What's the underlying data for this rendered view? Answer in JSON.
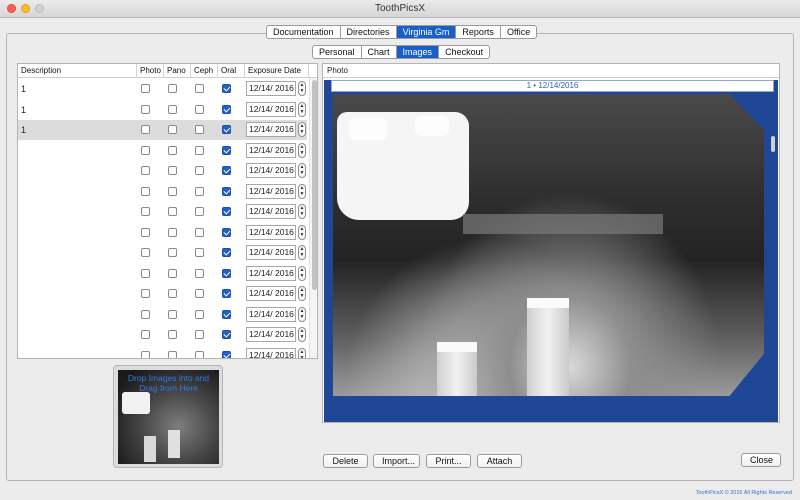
{
  "window": {
    "title": "ToothPicsX"
  },
  "top_tabs": [
    {
      "label": "Documentation",
      "selected": false
    },
    {
      "label": "Directories",
      "selected": false
    },
    {
      "label": "Virginia Gm",
      "selected": true
    },
    {
      "label": "Reports",
      "selected": false
    },
    {
      "label": "Office",
      "selected": false
    }
  ],
  "sub_tabs": [
    {
      "label": "Personal",
      "selected": false
    },
    {
      "label": "Chart",
      "selected": false
    },
    {
      "label": "Images",
      "selected": true
    },
    {
      "label": "Checkout",
      "selected": false
    }
  ],
  "table": {
    "columns": [
      "Description",
      "Photo",
      "Pano",
      "Ceph",
      "Oral",
      "Exposure Date"
    ],
    "rows": [
      {
        "description": "1",
        "photo": false,
        "pano": false,
        "ceph": false,
        "oral": true,
        "date": "12/14/ 2016",
        "selected": false
      },
      {
        "description": "1",
        "photo": false,
        "pano": false,
        "ceph": false,
        "oral": true,
        "date": "12/14/ 2016",
        "selected": false
      },
      {
        "description": "1",
        "photo": false,
        "pano": false,
        "ceph": false,
        "oral": true,
        "date": "12/14/ 2016",
        "selected": true
      },
      {
        "description": "",
        "photo": false,
        "pano": false,
        "ceph": false,
        "oral": true,
        "date": "12/14/ 2016",
        "selected": false
      },
      {
        "description": "",
        "photo": false,
        "pano": false,
        "ceph": false,
        "oral": true,
        "date": "12/14/ 2016",
        "selected": false
      },
      {
        "description": "",
        "photo": false,
        "pano": false,
        "ceph": false,
        "oral": true,
        "date": "12/14/ 2016",
        "selected": false
      },
      {
        "description": "",
        "photo": false,
        "pano": false,
        "ceph": false,
        "oral": true,
        "date": "12/14/ 2016",
        "selected": false
      },
      {
        "description": "",
        "photo": false,
        "pano": false,
        "ceph": false,
        "oral": true,
        "date": "12/14/ 2016",
        "selected": false
      },
      {
        "description": "",
        "photo": false,
        "pano": false,
        "ceph": false,
        "oral": true,
        "date": "12/14/ 2016",
        "selected": false
      },
      {
        "description": "",
        "photo": false,
        "pano": false,
        "ceph": false,
        "oral": true,
        "date": "12/14/ 2016",
        "selected": false
      },
      {
        "description": "",
        "photo": false,
        "pano": false,
        "ceph": false,
        "oral": true,
        "date": "12/14/ 2016",
        "selected": false
      },
      {
        "description": "",
        "photo": false,
        "pano": false,
        "ceph": false,
        "oral": true,
        "date": "12/14/ 2016",
        "selected": false
      },
      {
        "description": "",
        "photo": false,
        "pano": false,
        "ceph": false,
        "oral": true,
        "date": "12/14/ 2016",
        "selected": false
      },
      {
        "description": "",
        "photo": false,
        "pano": false,
        "ceph": false,
        "oral": true,
        "date": "12/14/ 2016",
        "selected": false
      }
    ]
  },
  "thumbnail": {
    "drop_text": "Drop Images into and Drag from Here"
  },
  "photo_panel": {
    "header": "Photo",
    "caption": "1 • 12/14/2016"
  },
  "buttons": {
    "delete": "Delete",
    "import": "Import...",
    "print": "Print...",
    "attach": "Attach",
    "close": "Close"
  },
  "footer": {
    "text": "ToothPicsX © 2016 All Rights Reserved"
  },
  "colors": {
    "accent": "#1a5fc7",
    "photo_bg": "#1f4795",
    "checkbox_on": "#2262c8"
  }
}
